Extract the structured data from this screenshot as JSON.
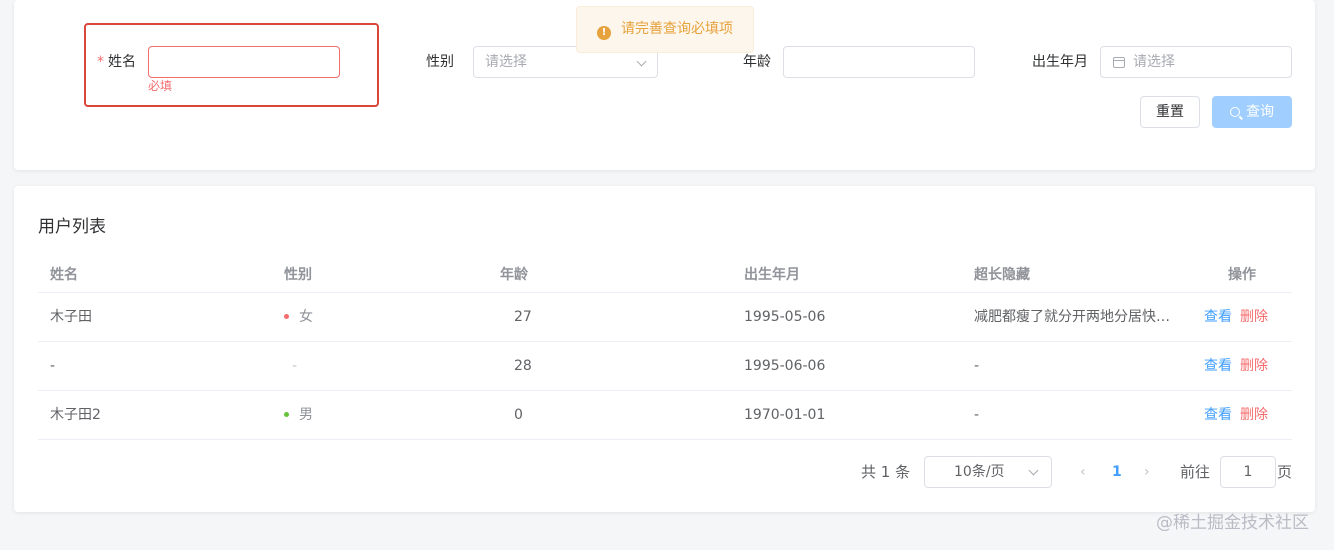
{
  "toast": {
    "message": "请完善查询必填项",
    "icon": "warning-icon"
  },
  "form": {
    "name": {
      "label": "姓名",
      "required_mark": "*",
      "value": "",
      "error": "必填"
    },
    "gender": {
      "label": "性别",
      "placeholder": "请选择"
    },
    "age": {
      "label": "年龄",
      "value": ""
    },
    "birth": {
      "label": "出生年月",
      "placeholder": "请选择"
    },
    "reset_label": "重置",
    "query_label": "查询"
  },
  "table": {
    "title": "用户列表",
    "headers": [
      "姓名",
      "性别",
      "年龄",
      "出生年月",
      "超长隐藏",
      "操作"
    ],
    "rows": [
      {
        "name": "木子田",
        "gender": "女",
        "gender_color": "#f56c6c",
        "age": "27",
        "birth": "1995-05-06",
        "long": "减肥都瘦了就分开两地分居快…",
        "view": "查看",
        "delete": "删除"
      },
      {
        "name": "-",
        "gender": "-",
        "gender_color": "",
        "age": "28",
        "birth": "1995-06-06",
        "long": "-",
        "view": "查看",
        "delete": "删除"
      },
      {
        "name": "木子田2",
        "gender": "男",
        "gender_color": "#67c23a",
        "age": "0",
        "birth": "1970-01-01",
        "long": "-",
        "view": "查看",
        "delete": "删除"
      }
    ]
  },
  "pagination": {
    "total_prefix": "共",
    "total": "1",
    "total_suffix": "条",
    "page_size": "10条/页",
    "current_page": "1",
    "jump_prefix": "前往",
    "jump_value": "1",
    "jump_suffix": "页"
  },
  "watermark": "@稀土掘金技术社区",
  "colors": {
    "primary": "#409eff",
    "danger": "#f56c6c",
    "warning": "#e6a23c",
    "success": "#67c23a"
  }
}
